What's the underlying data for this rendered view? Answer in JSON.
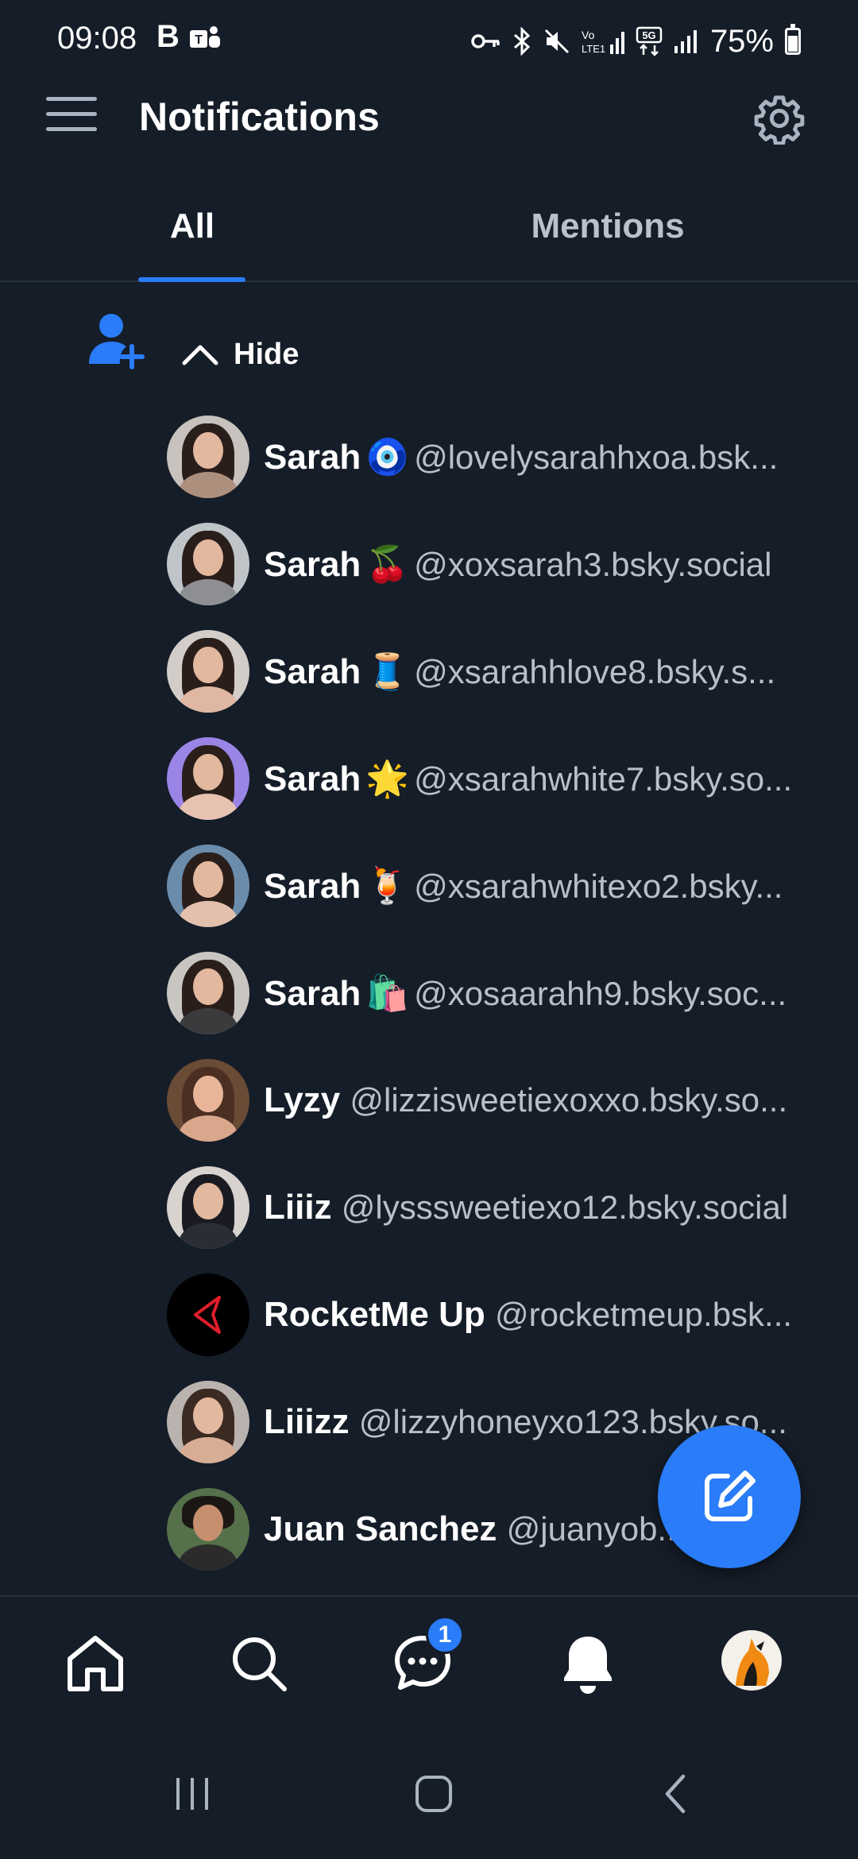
{
  "status_bar": {
    "time": "09:08",
    "b_indicator": "B",
    "battery": "75%",
    "icons": [
      "teams-icon",
      "key-icon",
      "bluetooth-icon",
      "mute-icon",
      "volte-icon",
      "signal-icon",
      "5g-icon",
      "signal-icon",
      "battery-icon"
    ]
  },
  "header": {
    "title": "Notifications",
    "menu_icon": "hamburger-menu-icon",
    "settings_icon": "gear-icon"
  },
  "tabs": [
    {
      "label": "All",
      "active": true
    },
    {
      "label": "Mentions",
      "active": false
    }
  ],
  "follow_group": {
    "icon": "person-add-icon",
    "toggle_label": "Hide",
    "toggle_icon": "chevron-up-icon"
  },
  "follows": [
    {
      "name": "Sarah",
      "emoji": "🧿",
      "handle": "@lovelysarahhxoa.bsk..."
    },
    {
      "name": "Sarah",
      "emoji": "🍒",
      "handle": "@xoxsarah3.bsky.social"
    },
    {
      "name": "Sarah",
      "emoji": "🧵",
      "handle": "@xsarahhlove8.bsky.s..."
    },
    {
      "name": "Sarah",
      "emoji": "🌟",
      "handle": "@xsarahwhite7.bsky.so..."
    },
    {
      "name": "Sarah",
      "emoji": "🍹",
      "handle": "@xsarahwhitexo2.bsky..."
    },
    {
      "name": "Sarah",
      "emoji": "🛍️",
      "handle": "@xosaarahh9.bsky.soc..."
    },
    {
      "name": "Lyzy",
      "emoji": "",
      "handle": "@lizzisweetiexoxxo.bsky.so..."
    },
    {
      "name": "Liiiz",
      "emoji": "",
      "handle": "@lysssweetiexo12.bsky.social"
    },
    {
      "name": "RocketMe Up",
      "emoji": "",
      "handle": "@rocketmeup.bsk..."
    },
    {
      "name": "Liiizz",
      "emoji": "",
      "handle": "@lizzyhoneyxo123.bsky.so..."
    },
    {
      "name": "Juan Sanchez",
      "emoji": "",
      "handle": "@juanyob..."
    }
  ],
  "fab": {
    "icon": "compose-icon"
  },
  "bottom_nav": {
    "items": [
      "home-icon",
      "search-icon",
      "chat-icon",
      "bell-icon",
      "profile-avatar"
    ],
    "chat_badge": "1"
  },
  "system_nav": [
    "recents-icon",
    "home-circle-icon",
    "back-icon"
  ],
  "colors": {
    "background": "#151d28",
    "accent": "#2a7cf8",
    "divider": "#26323f",
    "muted_text": "#b7c0ca"
  }
}
